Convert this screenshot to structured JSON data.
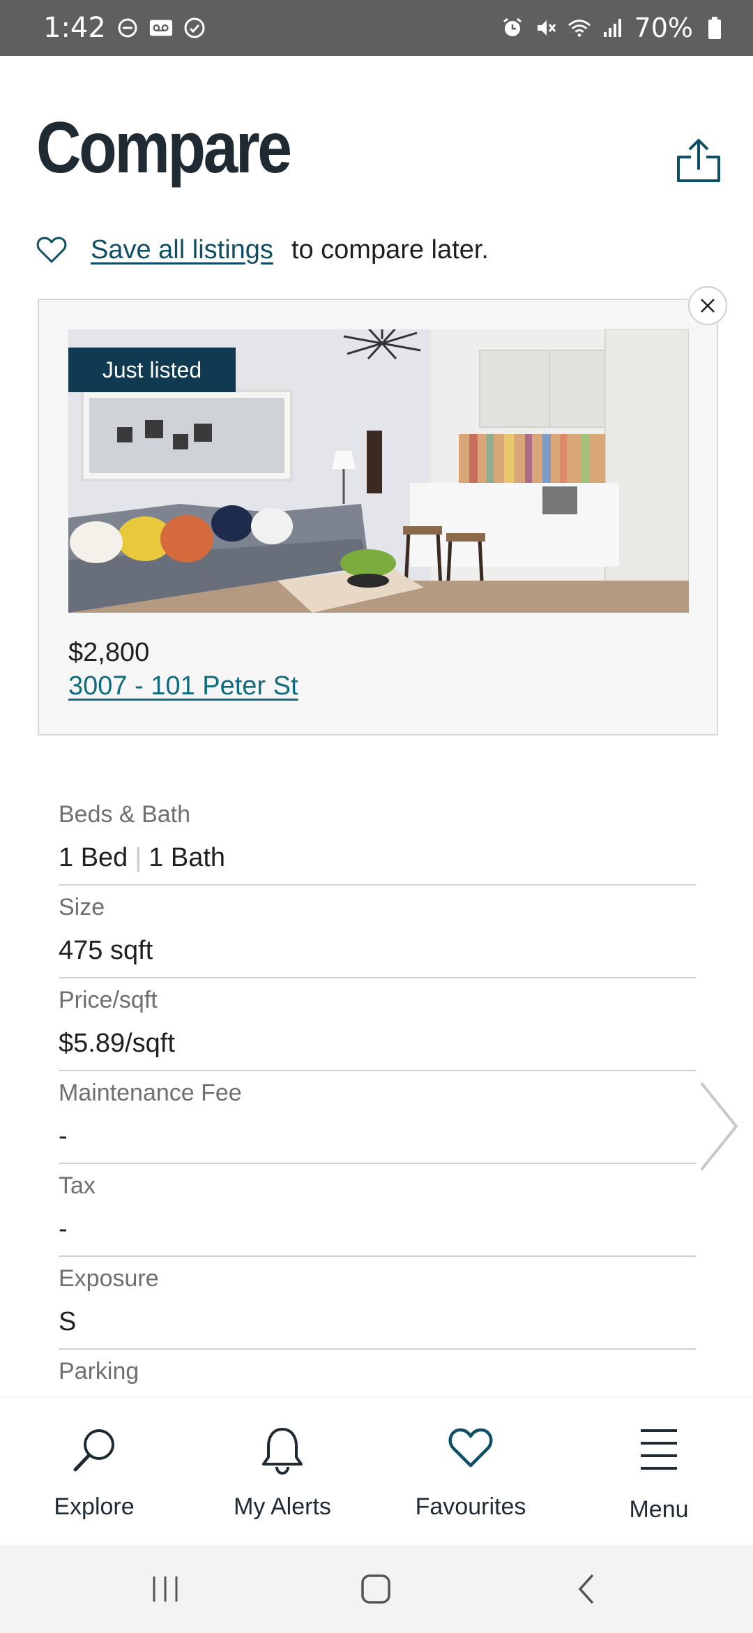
{
  "status_bar": {
    "time": "1:42",
    "battery": "70%",
    "left_icons": [
      "do-not-disturb-icon",
      "voicemail-icon",
      "sync-icon"
    ],
    "right_icons": [
      "alarm-icon",
      "mute-icon",
      "wifi-icon",
      "signal-icon",
      "battery-icon"
    ]
  },
  "header": {
    "title": "Compare",
    "share_icon": "share-icon"
  },
  "save_prompt": {
    "link_label": "Save all listings",
    "rest_text": "to compare later."
  },
  "listing": {
    "badge": "Just listed",
    "price": "$2,800",
    "address": "3007 - 101 Peter St"
  },
  "details": {
    "beds_label": "Beds & Bath",
    "beds_value": "1 Bed",
    "bath_value": "1 Bath",
    "size_label": "Size",
    "size_value": "475 sqft",
    "price_sqft_label": "Price/sqft",
    "price_sqft_value": "$5.89/sqft",
    "maintenance_label": "Maintenance Fee",
    "maintenance_value": "-",
    "tax_label": "Tax",
    "tax_value": "-",
    "exposure_label": "Exposure",
    "exposure_value": "S",
    "parking_label": "Parking"
  },
  "bottom_nav": {
    "explore": "Explore",
    "alerts": "My Alerts",
    "favourites": "Favourites",
    "menu": "Menu"
  },
  "colors": {
    "brand_dark": "#0f3a52",
    "link": "#0f6b80",
    "title": "#1f2a33"
  }
}
